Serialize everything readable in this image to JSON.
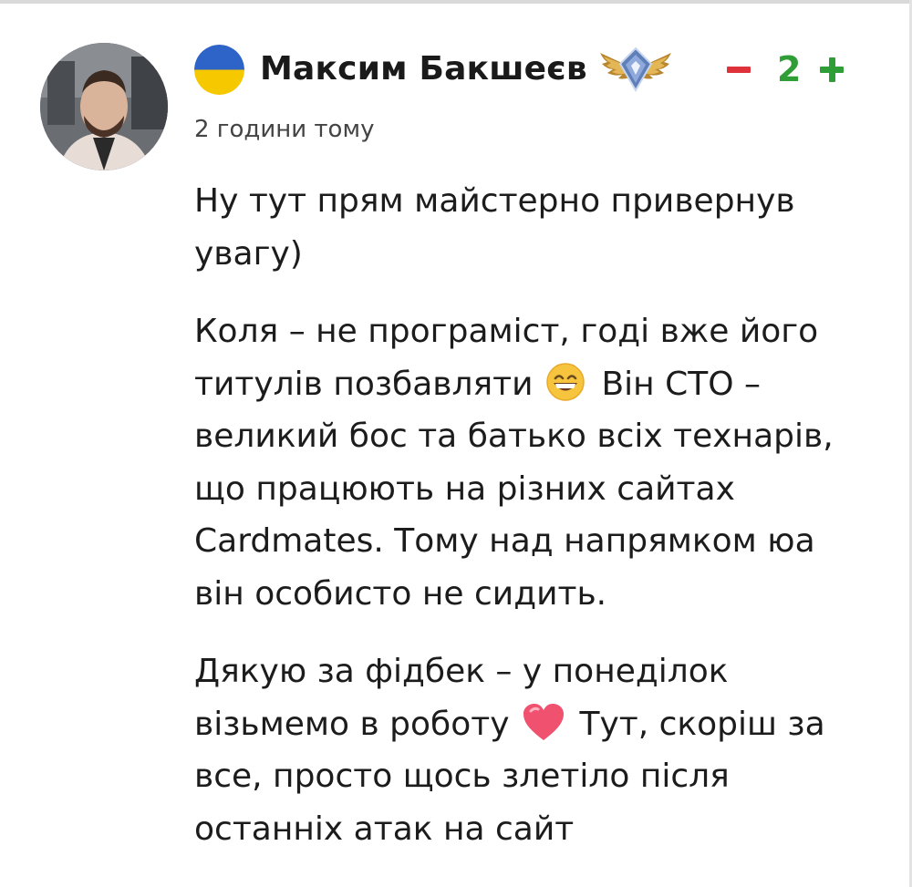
{
  "comment": {
    "author": "Максим Бакшеєв",
    "timestamp": "2 години тому",
    "vote_count": "2",
    "flag_icon": "ukraine-flag-icon",
    "badge_icon": "winged-badge-icon",
    "avatar": "user-avatar-photo",
    "paragraphs": {
      "p1": "Ну тут прям майстерно привернув увагу)",
      "p2a": "Коля – не програміст, годі вже його титулів позбавляти",
      "p2b": "Він CTO – великий бос та батько всіх технарів, що працюють на різних сайтах Cardmates. Тому над напрямком юа він особисто не сидить.",
      "p3a": "Дякую за фідбек – у понеділок візьмемо в роботу",
      "p3b": "Тут, скоріш за все, просто щось злетіло після останніх атак на сайт"
    },
    "emojis": [
      "grinning-face-emoji",
      "pink-heart-emoji"
    ]
  },
  "colors": {
    "vote_minus": "#e0323a",
    "vote_plus": "#2f9e36",
    "flag_blue": "#2e63c8",
    "flag_yellow": "#f6c800"
  }
}
